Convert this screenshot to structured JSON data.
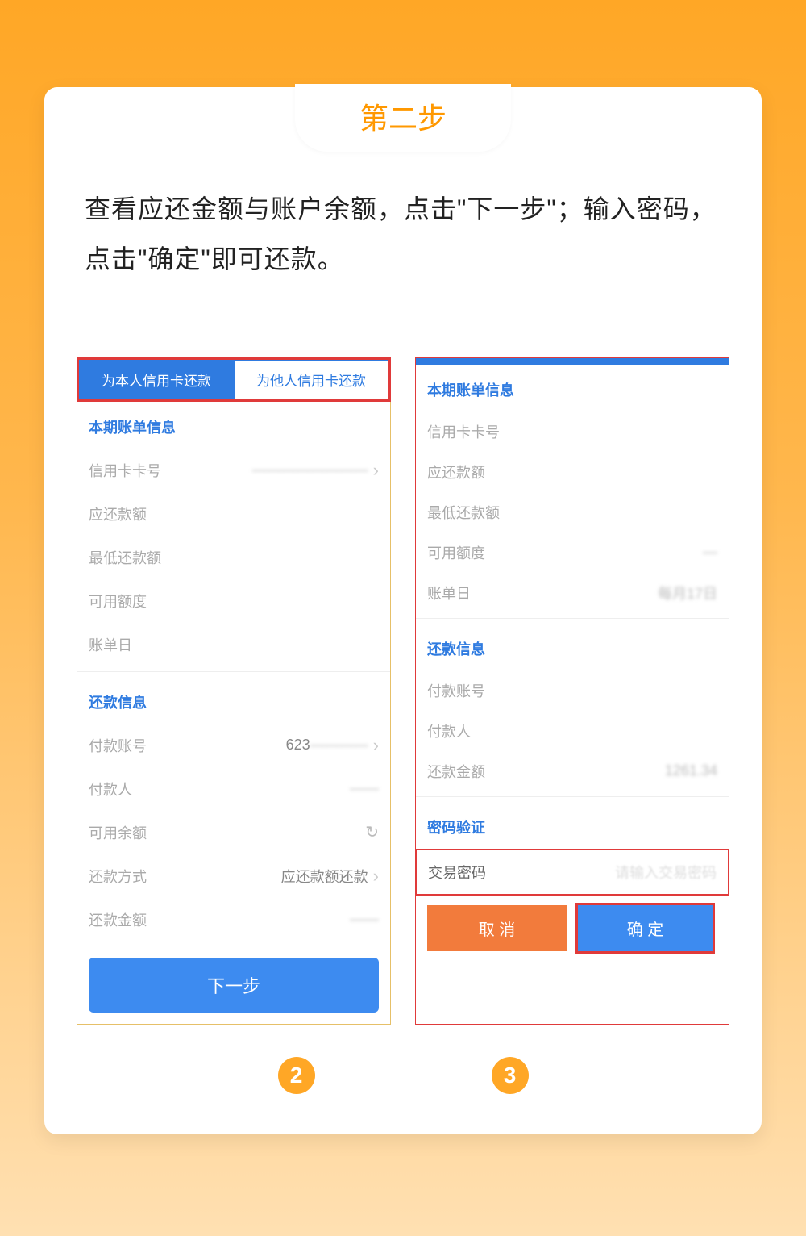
{
  "step_title": "第二步",
  "instruction": "查看应还金额与账户余额，点击\"下一步\"；输入密码，点击\"确定\"即可还款。",
  "left": {
    "tab_active": "为本人信用卡还款",
    "tab_inactive": "为他人信用卡还款",
    "section_bill": "本期账单信息",
    "card_no": "信用卡卡号",
    "due_amount": "应还款额",
    "min_due": "最低还款额",
    "avail_limit": "可用额度",
    "bill_date": "账单日",
    "section_repay": "还款信息",
    "pay_account": "付款账号",
    "pay_account_val": "623",
    "payer": "付款人",
    "avail_balance": "可用余额",
    "repay_method": "还款方式",
    "repay_method_val": "应还款额还款",
    "repay_amount": "还款金额",
    "next_btn": "下一步"
  },
  "right": {
    "section_bill": "本期账单信息",
    "card_no": "信用卡卡号",
    "due_amount": "应还款额",
    "min_due": "最低还款额",
    "avail_limit": "可用额度",
    "bill_date": "账单日",
    "bill_date_val": "每月17日",
    "section_repay": "还款信息",
    "pay_account": "付款账号",
    "payer": "付款人",
    "repay_amount": "还款金额",
    "repay_amount_val": "1261.34",
    "section_pwd": "密码验证",
    "txn_pwd": "交易密码",
    "txn_pwd_ph": "请输入交易密码",
    "cancel": "取 消",
    "confirm": "确 定"
  },
  "badges": {
    "b2": "2",
    "b3": "3"
  }
}
